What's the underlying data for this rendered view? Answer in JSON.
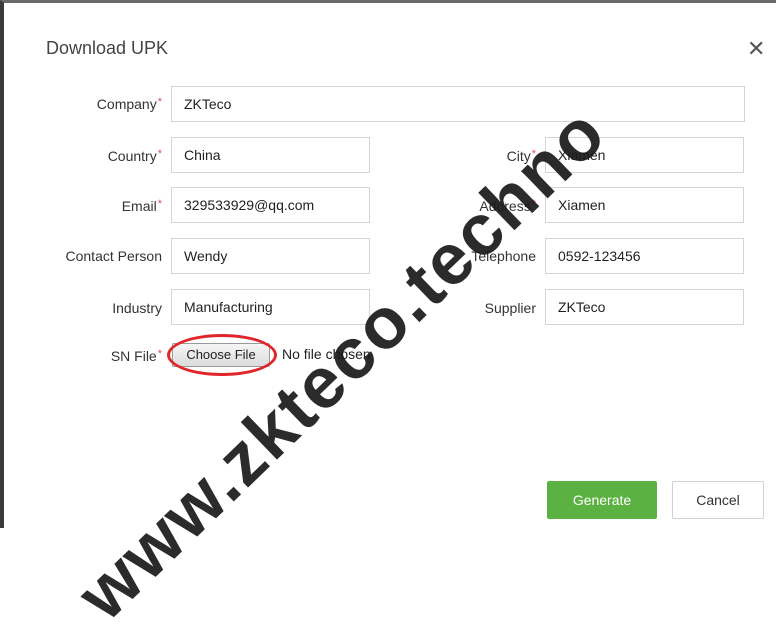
{
  "dialog": {
    "title": "Download UPK",
    "close_glyph": "✕"
  },
  "form": {
    "company": {
      "label": "Company",
      "value": "ZKTeco",
      "required": true
    },
    "country": {
      "label": "Country",
      "value": "China",
      "required": true
    },
    "city": {
      "label": "City",
      "value": "Xiamen",
      "required": true
    },
    "email": {
      "label": "Email",
      "value": "329533929@qq.com",
      "required": true
    },
    "address": {
      "label": "Address",
      "value": "Xiamen",
      "required": true
    },
    "contact_person": {
      "label": "Contact Person",
      "value": "Wendy",
      "required": false
    },
    "telephone": {
      "label": "Telephone",
      "value": "0592-123456",
      "required": false
    },
    "industry": {
      "label": "Industry",
      "value": "Manufacturing",
      "required": false
    },
    "supplier": {
      "label": "Supplier",
      "value": "ZKTeco",
      "required": false
    },
    "sn_file": {
      "label": "SN File",
      "button_label": "Choose File",
      "status": "No file chosen",
      "required": true
    },
    "required_mark": "*"
  },
  "actions": {
    "generate_label": "Generate",
    "cancel_label": "Cancel"
  },
  "watermark": {
    "text": "www.zkteco.techno"
  },
  "colors": {
    "accent_green": "#5bb142",
    "required_red": "#d9534f",
    "highlight_red": "#e0262b"
  }
}
